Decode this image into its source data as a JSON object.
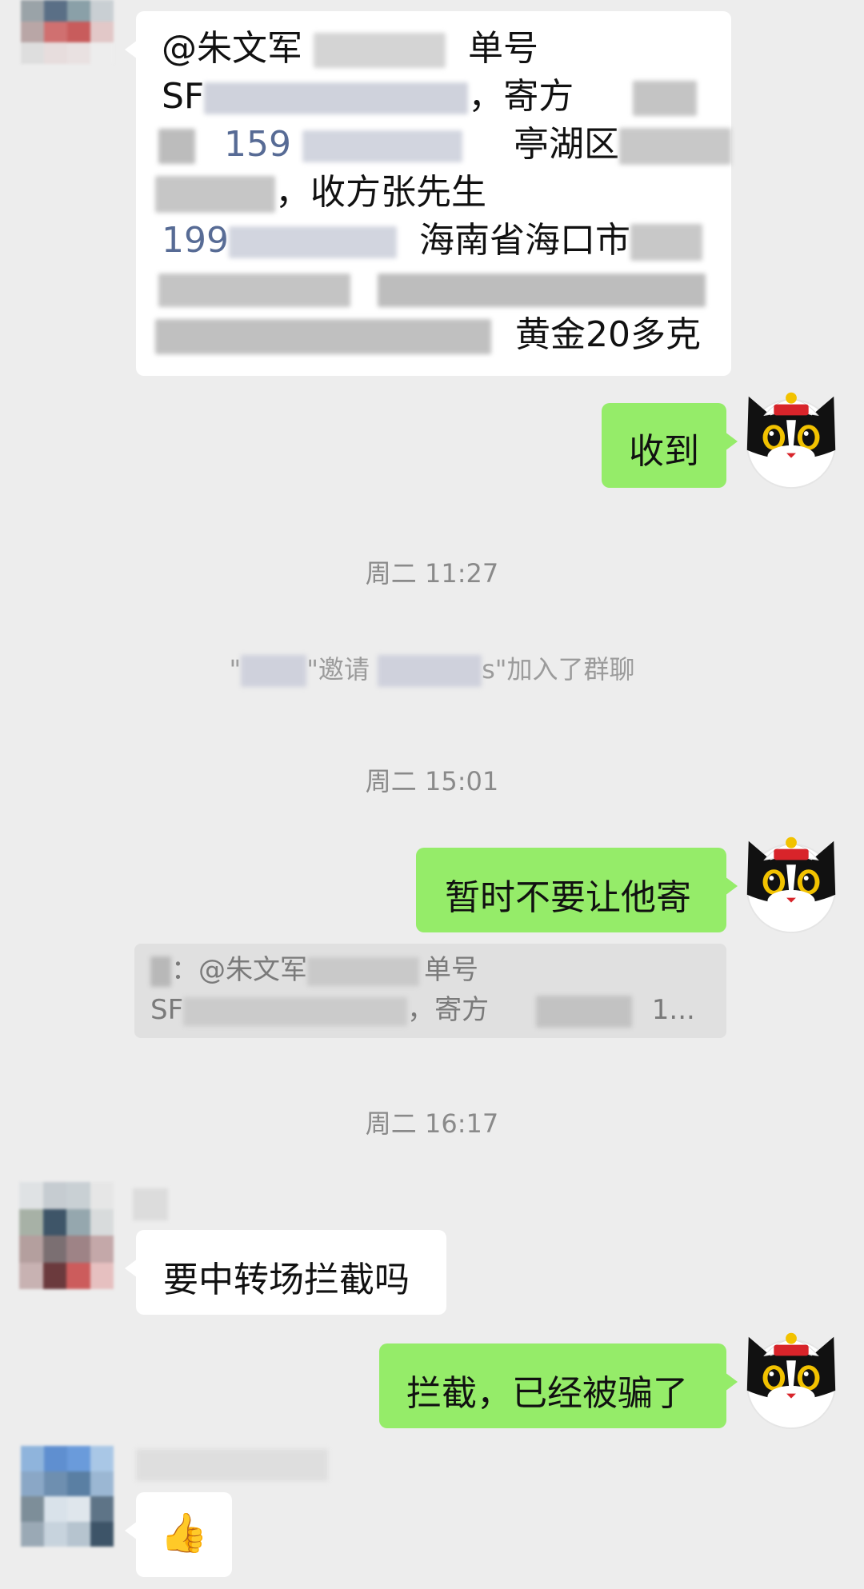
{
  "messages": {
    "m1": {
      "line1_prefix": "@朱文军",
      "line1_suffix": "单号",
      "line2_prefix": "SF",
      "line2_sender": "，寄方",
      "line3_phone": "159",
      "line3_district": "亭湖区",
      "line4_receiver": "，收方张先生",
      "line5_phone": "199",
      "line5_city": "海南省海口市",
      "line7_item": "黄金20多克"
    },
    "m2": {
      "text": "收到"
    },
    "m3": {
      "text": "暂时不要让他寄"
    },
    "m4": {
      "text": "要中转场拦截吗"
    },
    "m5": {
      "text": "拦截，已经被骗了"
    },
    "m6": {
      "emoji": "👍"
    }
  },
  "system": {
    "time1": "周二 11:27",
    "invite_open": "\"",
    "invite_mid": "\"邀请",
    "invite_close": "s\"加入了群聊",
    "time2": "周二 15:01",
    "time3": "周二 16:17"
  },
  "quote": {
    "line1_sep": "：",
    "line1_prefix": "@朱文军",
    "line1_suffix": "单号",
    "line2_prefix": "SF",
    "line2_sender": "，寄方",
    "line2_tail": "1..."
  },
  "colors": {
    "background": "#ededed",
    "bubble_self": "#95ec69",
    "bubble_other": "#ffffff",
    "link": "#576b95"
  }
}
